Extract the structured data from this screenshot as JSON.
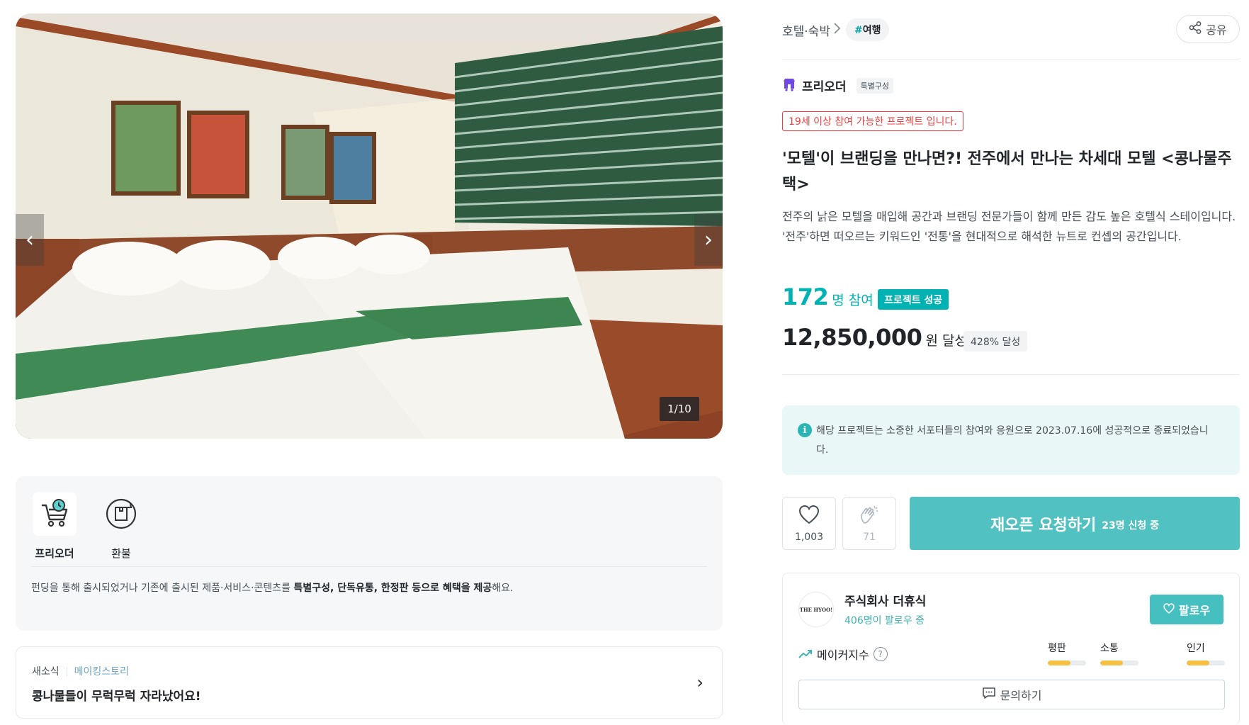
{
  "gallery": {
    "counter": "1/10",
    "prev_arrow": "‹",
    "next_arrow": "›"
  },
  "benefit": {
    "items": [
      {
        "label": "프리오더",
        "icon": "cart-clock-icon"
      },
      {
        "label": "환불",
        "icon": "refund-icon"
      }
    ],
    "desc_prefix": "펀딩을 통해 출시되었거나 기존에 출시된 제품·서비스·콘텐츠를 ",
    "desc_bold1": "특별구성, 단독유통, 한정판 등으로 혜택을 제공",
    "desc_suffix": "해요."
  },
  "news": {
    "tag1": "새소식",
    "tag2": "메이킹스토리",
    "title": "콩나물들이 무럭무럭 자라났어요!",
    "chevron": "›"
  },
  "header": {
    "category": "호텔·숙박",
    "tag_hash": "#",
    "tag": "여행",
    "share": "공유"
  },
  "project": {
    "type": "프리오더",
    "type_badge": "특별구성",
    "age_notice": "19세 이상 참여 가능한 프로젝트 입니다.",
    "title": "'모텔'이 브랜딩을 만나면?! 전주에서 만나는 차세대 모텔 <콩나물주택>",
    "description": "전주의 낡은 모텔을 매입해 공간과 브랜딩 전문가들이 함께 만든 감도 높은 호텔식 스테이입니다. '전주'하면 떠오르는 키워드인 '전통'을 현대적으로 해석한 뉴트로 컨셉의 공간입니다.",
    "participants": "172",
    "participants_unit": "명 참여",
    "status_badge": "프로젝트 성공",
    "amount": "12,850,000",
    "amount_unit": "원 달성",
    "percent": "428% 달성"
  },
  "notice": {
    "icon": "i",
    "text": "해당 프로젝트는 소중한 서포터들의 참여와 응원으로 2023.07.16에 성공적으로 종료되었습니다."
  },
  "actions": {
    "like_count": "1,003",
    "cheer_count": "71",
    "reopen_label": "재오픈 요청하기",
    "reopen_sub": "23명 신청 중"
  },
  "maker": {
    "logo_text": "THE HYOO!",
    "name": "주식회사 더휴식",
    "followers": "406명이 팔로우 중",
    "follow_label": "팔로우",
    "index_label": "메이커지수",
    "help": "?",
    "metrics": [
      {
        "label": "평판",
        "level": 0.6
      },
      {
        "label": "소통",
        "level": 0.6
      },
      {
        "label": "인기",
        "level": 0.6
      }
    ],
    "inquiry_label": "문의하기"
  },
  "colors": {
    "accent": "#00b2b2",
    "button": "#52c1c1",
    "age_warning": "#f03e3e",
    "metric_fill": "#f6c044"
  }
}
